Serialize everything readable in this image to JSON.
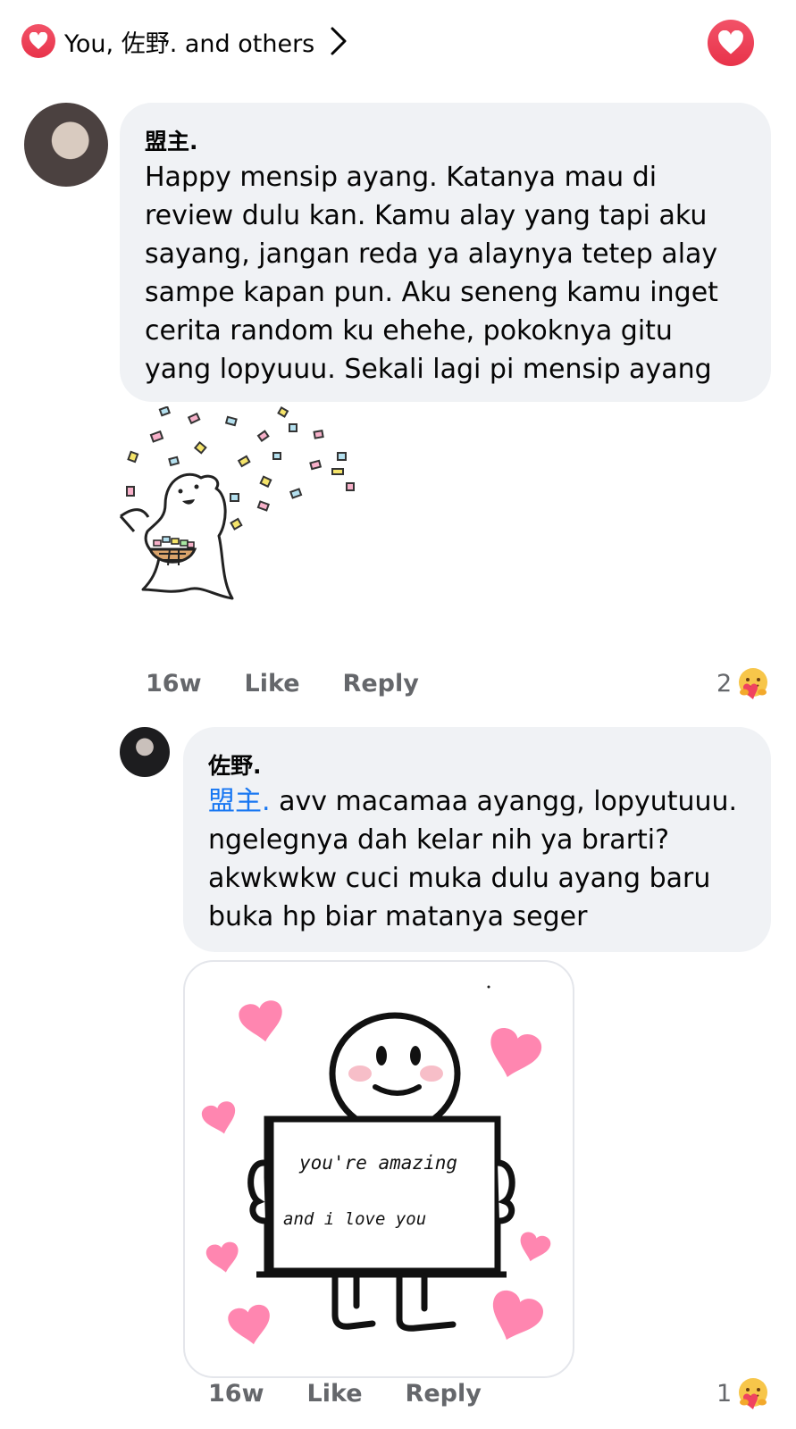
{
  "header": {
    "reactions_summary": "You, 佐野. and others",
    "reaction_icon": "heart-icon",
    "chevron_icon": "chevron-right-icon",
    "heart_color": "#e8334a"
  },
  "comments": [
    {
      "author": "盟主.",
      "text": "Happy mensip ayang. Katanya mau di review dulu kan. Kamu alay yang tapi aku sayang, jangan reda ya alaynya tetep alay sampe kapan pun. Aku seneng kamu inget cerita random ku ehehe, pokoknya gitu yang lopyuuu. Sekali lagi pi mensip ayang",
      "time": "16w",
      "like_label": "Like",
      "reply_label": "Reply",
      "reaction_count": "2",
      "reaction_icon": "care-emoji-icon",
      "sticker": "confetti-sticker"
    },
    {
      "author": "佐野.",
      "mention": "盟主.",
      "text": " avv macamaa ayangg, lopyutuuu. ngelegnya dah kelar nih ya brarti? akwkwkw cuci muka dulu ayang baru buka hp biar matanya seger",
      "time": "16w",
      "like_label": "Like",
      "reply_label": "Reply",
      "reaction_count": "1",
      "reaction_icon": "care-emoji-icon",
      "sticker": "love-sign-sticker",
      "sticker_text_line1": "you're amazing",
      "sticker_text_line2": "and i love you"
    }
  ],
  "colors": {
    "bubble_bg": "#f0f2f5",
    "meta_text": "#65676b",
    "mention": "#1877f2",
    "heart": "#ff86b0"
  }
}
